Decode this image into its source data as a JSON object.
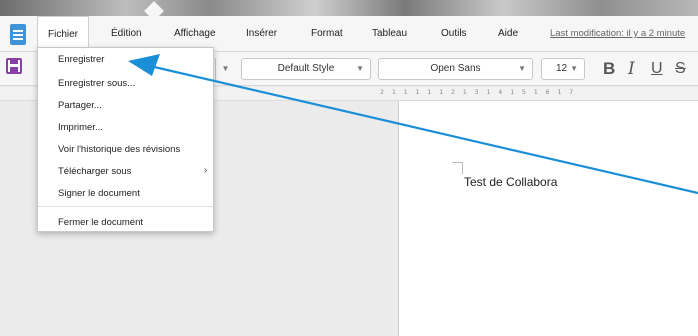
{
  "menubar": {
    "items": [
      {
        "label": "Fichier"
      },
      {
        "label": "Édition"
      },
      {
        "label": "Affichage"
      },
      {
        "label": "Insérer"
      },
      {
        "label": "Format"
      },
      {
        "label": "Tableau"
      },
      {
        "label": "Outils"
      },
      {
        "label": "Aide"
      }
    ],
    "last_modification": "Last modification: il y a 2 minute"
  },
  "toolbar": {
    "style": "Default Style",
    "font": "Open Sans",
    "size": "12",
    "bold": "B",
    "italic": "I",
    "underline": "U",
    "strike": "S",
    "save_icon": "save-icon",
    "accent_color": "#8a3fa8"
  },
  "ruler": {
    "labels": "2 1 1 1 1 1 2 1 3 1 4 1 5 1 6 1 7"
  },
  "file_menu": {
    "items": [
      {
        "label": "Enregistrer"
      },
      {
        "label": "Enregistrer sous..."
      },
      {
        "label": "Partager..."
      },
      {
        "label": "Imprimer..."
      },
      {
        "label": "Voir l'historique des révisions"
      },
      {
        "label": "Télécharger sous"
      },
      {
        "label": "Signer le document"
      },
      {
        "label": "Fermer le document"
      }
    ],
    "submenu_chevron": "›"
  },
  "document": {
    "text": "Test de Collabora"
  },
  "colors": {
    "annotation_arrow": "#1a8fd8",
    "app_icon": "#3f93d6"
  }
}
